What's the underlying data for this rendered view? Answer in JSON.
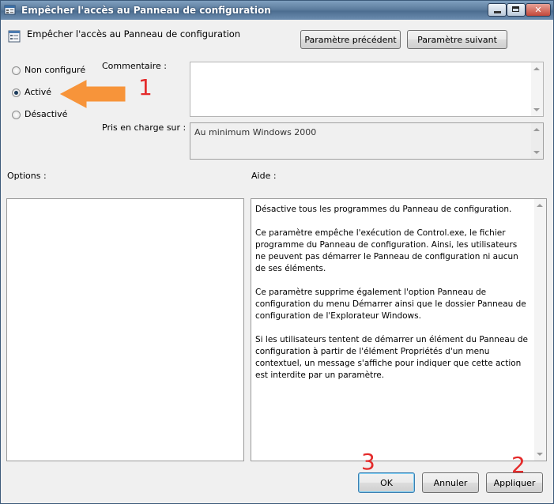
{
  "window": {
    "title": "Empêcher l'accès au Panneau de configuration",
    "controls": {
      "close": "✕"
    }
  },
  "header": {
    "policy_name": "Empêcher l'accès au Panneau de configuration",
    "prev_button": "Paramètre précédent",
    "next_button": "Paramètre suivant"
  },
  "state": {
    "options": [
      {
        "label": "Non configuré",
        "checked": false
      },
      {
        "label": "Activé",
        "checked": true
      },
      {
        "label": "Désactivé",
        "checked": false
      }
    ]
  },
  "comment": {
    "label": "Commentaire :",
    "value": ""
  },
  "supported": {
    "label": "Pris en charge sur :",
    "value": "Au minimum Windows 2000"
  },
  "options_panel": {
    "label": "Options :"
  },
  "help": {
    "label": "Aide :",
    "paragraphs": [
      "Désactive tous les programmes du Panneau de configuration.",
      "Ce paramètre empêche l'exécution de Control.exe, le fichier programme du Panneau de configuration. Ainsi, les utilisateurs ne peuvent pas démarrer le Panneau de configuration ni aucun de ses éléments.",
      "Ce paramètre supprime également l'option Panneau de configuration du menu Démarrer ainsi que le dossier Panneau de configuration de l'Explorateur Windows.",
      "Si les utilisateurs tentent de démarrer un élément du Panneau de configuration à partir de l'élément Propriétés d'un menu contextuel, un message s'affiche pour indiquer que cette action est interdite par un paramètre."
    ]
  },
  "footer": {
    "ok": "OK",
    "cancel": "Annuler",
    "apply": "Appliquer"
  },
  "annotations": {
    "n1": "1",
    "n2": "2",
    "n3": "3",
    "arrow_color": "#f7943a",
    "number_color": "#e42b2b"
  }
}
